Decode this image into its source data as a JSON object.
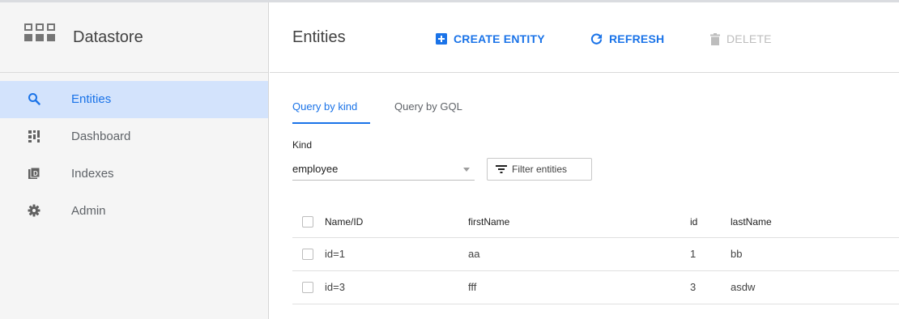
{
  "sidebar": {
    "product_title": "Datastore",
    "product_icon": "datastore-grid-icon",
    "items": [
      {
        "label": "Entities",
        "icon": "search-icon",
        "active": true
      },
      {
        "label": "Dashboard",
        "icon": "dashboard-icon",
        "active": false
      },
      {
        "label": "Indexes",
        "icon": "indexes-icon",
        "active": false
      },
      {
        "label": "Admin",
        "icon": "gear-icon",
        "active": false
      }
    ]
  },
  "toolbar": {
    "title": "Entities",
    "create_label": "CREATE ENTITY",
    "refresh_label": "REFRESH",
    "delete_label": "DELETE"
  },
  "tabs": [
    {
      "label": "Query by kind",
      "active": true
    },
    {
      "label": "Query by GQL",
      "active": false
    }
  ],
  "query": {
    "kind_label": "Kind",
    "kind_value": "employee",
    "filter_label": "Filter entities"
  },
  "table": {
    "columns": [
      "Name/ID",
      "firstName",
      "id",
      "lastName"
    ],
    "rows": [
      {
        "name_id": "id=1",
        "firstName": "aa",
        "id": "1",
        "lastName": "bb"
      },
      {
        "name_id": "id=3",
        "firstName": "fff",
        "id": "3",
        "lastName": "asdw"
      }
    ]
  },
  "colors": {
    "accent": "#1a73e8",
    "active_nav_bg": "#d3e3fc",
    "sidebar_bg": "#f5f5f5",
    "disabled": "#bdbdbd"
  }
}
